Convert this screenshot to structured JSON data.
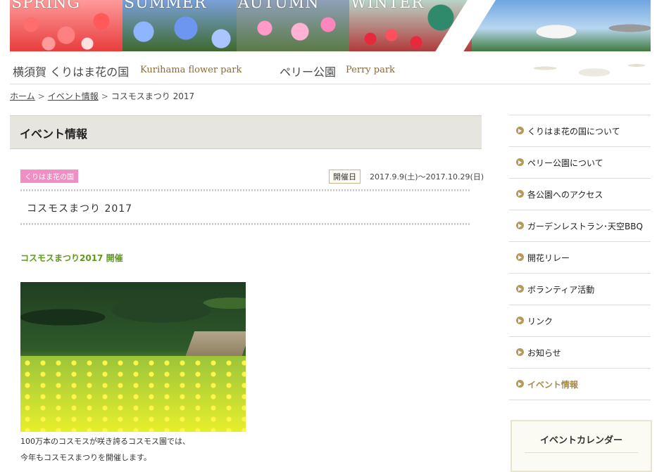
{
  "banner": {
    "seasons": [
      "SPRING",
      "SUMMER",
      "AUTUMN",
      "WINTER"
    ]
  },
  "parks": [
    {
      "jp": "横須賀 くりはま花の国",
      "en": "Kurihama flower park"
    },
    {
      "jp": "ペリー公園",
      "en": "Perry park"
    }
  ],
  "breadcrumb": {
    "home": "ホーム",
    "events": "イベント情報",
    "current": "コスモスまつり 2017"
  },
  "main": {
    "section_title": "イベント情報",
    "category_tag": "くりはま花の国",
    "date_label": "開催日",
    "date_value": "2017.9.9(土)～2017.10.29(日)",
    "event_title": "コスモスまつり 2017",
    "subheading": "コスモスまつり2017 開催",
    "body_lines": [
      "100万本のコスモスが咲き誇るコスモス園では、",
      "今年もコスモスまつりを開催します。"
    ]
  },
  "sidebar": {
    "items": [
      {
        "label": "くりはま花の国について",
        "active": false
      },
      {
        "label": "ペリー公園について",
        "active": false
      },
      {
        "label": "各公園へのアクセス",
        "active": false
      },
      {
        "label": "ガーデンレストラン･天空BBQ",
        "active": false
      },
      {
        "label": "開花リレー",
        "active": false
      },
      {
        "label": "ボランティア活動",
        "active": false
      },
      {
        "label": "リンク",
        "active": false
      },
      {
        "label": "お知らせ",
        "active": false
      },
      {
        "label": "イベント情報",
        "active": true
      }
    ],
    "calendar_title": "イベントカレンダー"
  }
}
